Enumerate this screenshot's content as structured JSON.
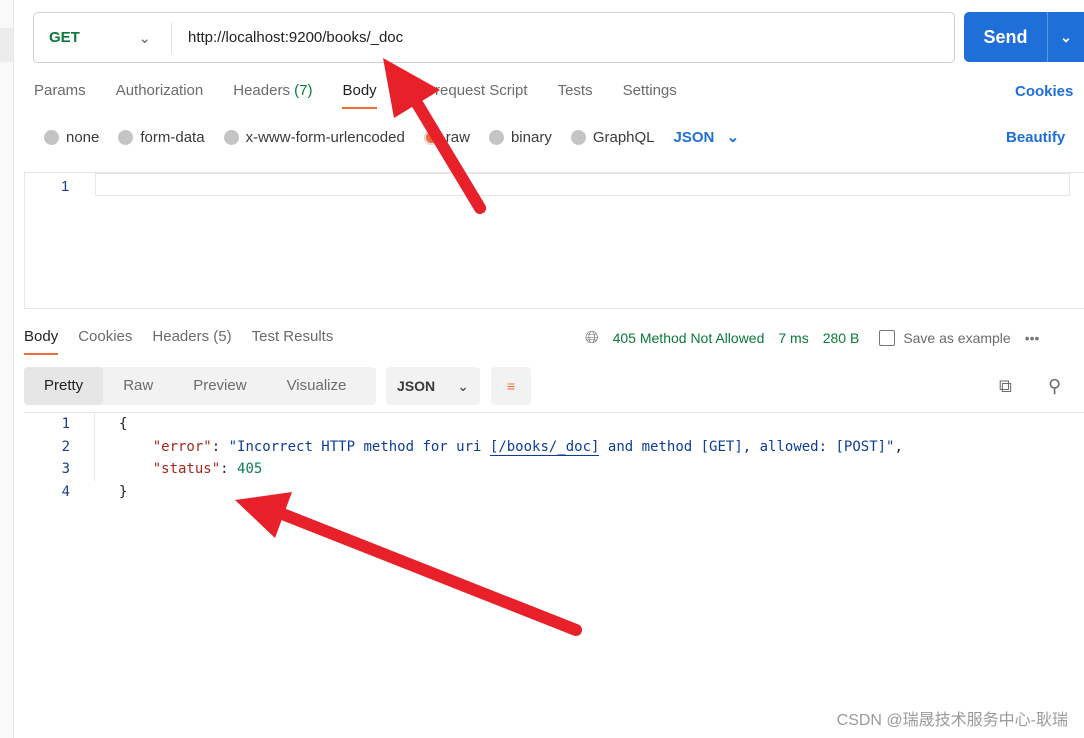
{
  "request": {
    "method": "GET",
    "url": "http://localhost:9200/books/_doc",
    "send_label": "Send"
  },
  "tabs": [
    {
      "label": "Params"
    },
    {
      "label": "Authorization"
    },
    {
      "label": "Headers",
      "count": "(7)"
    },
    {
      "label": "Body"
    },
    {
      "label": "Pre-request Script"
    },
    {
      "label": "Tests"
    },
    {
      "label": "Settings"
    }
  ],
  "cookies_label": "Cookies",
  "body_types": [
    "none",
    "form-data",
    "x-www-form-urlencoded",
    "raw",
    "binary",
    "GraphQL"
  ],
  "selected_body_type": "raw",
  "body_format": "JSON",
  "beautify_label": "Beautify",
  "request_editor": {
    "line": "1"
  },
  "response": {
    "tabs": [
      {
        "label": "Body"
      },
      {
        "label": "Cookies"
      },
      {
        "label": "Headers",
        "count": "(5)"
      },
      {
        "label": "Test Results"
      }
    ],
    "status": "405 Method Not Allowed",
    "time": "7 ms",
    "size": "280 B",
    "save_label": "Save as example",
    "views": [
      "Pretty",
      "Raw",
      "Preview",
      "Visualize"
    ],
    "format": "JSON",
    "lines": [
      "1",
      "2",
      "3",
      "4"
    ],
    "code": {
      "open": "{",
      "error_key": "\"error\"",
      "error_pre": "\"Incorrect HTTP method for uri ",
      "error_uri": "[/books/_doc]",
      "error_post": " and method [GET], allowed: [POST]\"",
      "status_key": "\"status\"",
      "status_val": "405",
      "close": "}"
    }
  },
  "watermark": "CSDN @瑞晟技术服务中心-耿瑞",
  "colors": {
    "accent": "#1f6fd8",
    "tab_underline": "#f26b3a",
    "status": "#0a7a3a",
    "annotation_arrow": "#e8202a"
  }
}
